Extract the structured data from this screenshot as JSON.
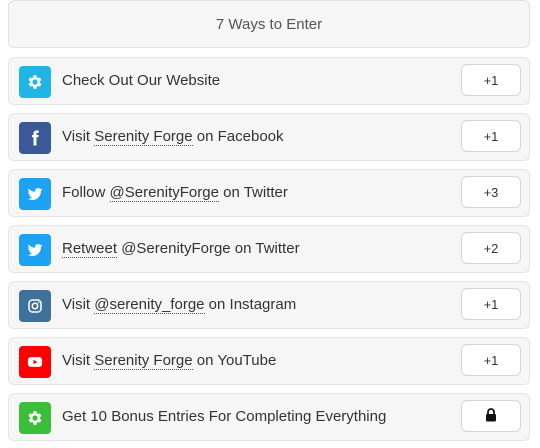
{
  "header": {
    "title": "7 Ways to Enter"
  },
  "entries": [
    {
      "icon": "gear-icon",
      "color": "#1fb6e5",
      "pre": "Check Out Our Website",
      "link": "",
      "post": "",
      "points": "+1"
    },
    {
      "icon": "facebook-icon",
      "color": "#3b5998",
      "pre": "Visit ",
      "link": "Serenity Forge",
      "post": " on Facebook",
      "points": "+1"
    },
    {
      "icon": "twitter-icon",
      "color": "#1da1f2",
      "pre": "Follow ",
      "link": "@SerenityForge",
      "post": " on Twitter",
      "points": "+3"
    },
    {
      "icon": "twitter-icon",
      "color": "#1da1f2",
      "pre": "",
      "link": "Retweet",
      "post": " @SerenityForge on Twitter",
      "points": "+2"
    },
    {
      "icon": "instagram-icon",
      "color": "#3f729b",
      "pre": "Visit ",
      "link": "@serenity_forge",
      "post": " on Instagram",
      "points": "+1"
    },
    {
      "icon": "youtube-icon",
      "color": "#ff0000",
      "pre": "Visit ",
      "link": "Serenity Forge",
      "post": " on YouTube",
      "points": "+1"
    },
    {
      "icon": "gear-icon",
      "color": "#3bbf3b",
      "pre": "Get 10 Bonus Entries For Completing Everything",
      "link": "",
      "post": "",
      "points": "lock-icon"
    }
  ]
}
